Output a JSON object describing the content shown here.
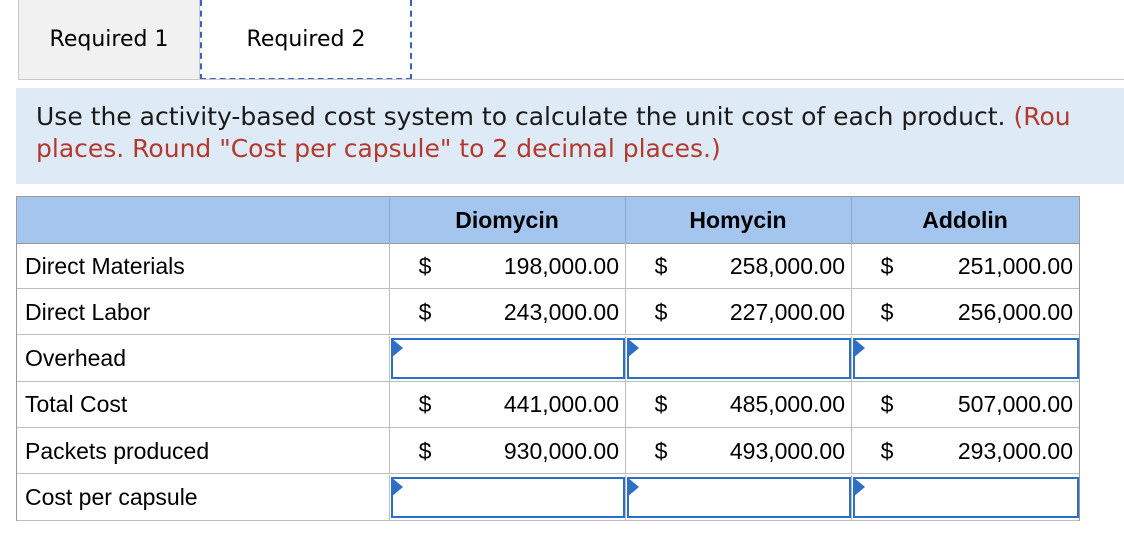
{
  "tabs": [
    {
      "label": "Required 1"
    },
    {
      "label": "Required 2"
    }
  ],
  "instruction": {
    "text": "Use the activity-based cost system to calculate the unit cost of each product. ",
    "red_line1": "(Rou",
    "red_line2": "places. Round \"Cost per capsule\" to 2 decimal places.)"
  },
  "table": {
    "columns": [
      "Diomycin",
      "Homycin",
      "Addolin"
    ],
    "currency_symbol": "$",
    "rows": [
      {
        "label": "Direct Materials",
        "values": [
          "198,000.00",
          "258,000.00",
          "251,000.00"
        ],
        "input": false
      },
      {
        "label": "Direct Labor",
        "values": [
          "243,000.00",
          "227,000.00",
          "256,000.00"
        ],
        "input": false
      },
      {
        "label": "Overhead",
        "values": [
          "",
          "",
          ""
        ],
        "input": true
      },
      {
        "label": "Total Cost",
        "values": [
          "441,000.00",
          "485,000.00",
          "507,000.00"
        ],
        "input": false
      },
      {
        "label": "Packets produced",
        "values": [
          "930,000.00",
          "493,000.00",
          "293,000.00"
        ],
        "input": false
      },
      {
        "label": "Cost per capsule",
        "values": [
          "",
          "",
          ""
        ],
        "input": true
      }
    ]
  },
  "colors": {
    "header_bg": "#a4c6ee",
    "instruction_bg": "#deebf7",
    "input_border": "#2d6fc4",
    "instruction_red": "#b5382c"
  }
}
